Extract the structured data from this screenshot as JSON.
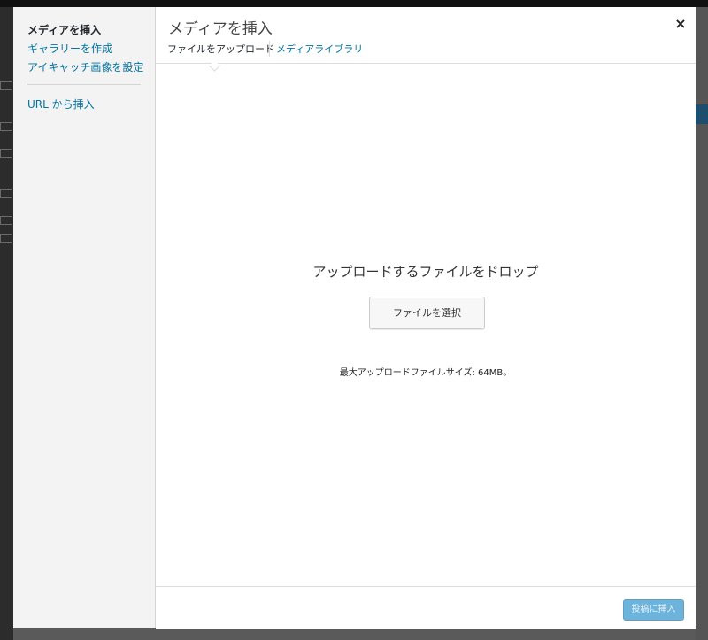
{
  "modal": {
    "menu": {
      "items": [
        {
          "label": "メディアを挿入",
          "active": true
        },
        {
          "label": "ギャラリーを作成",
          "active": false
        },
        {
          "label": "アイキャッチ画像を設定",
          "active": false
        },
        {
          "label": "URL から挿入",
          "active": false
        }
      ]
    },
    "title": "メディアを挿入",
    "close_glyph": "×",
    "tabs": [
      {
        "label": "ファイルをアップロード",
        "active": true
      },
      {
        "label": "メディアライブラリ",
        "active": false
      }
    ],
    "uploader": {
      "drop_text": "アップロードするファイルをドロップ",
      "select_button": "ファイルを選択",
      "max_size": "最大アップロードファイルサイズ: 64MB。"
    },
    "toolbar": {
      "insert_button": "投稿に挿入"
    }
  },
  "colors": {
    "link": "#0074a2",
    "primary_button_disabled": "#6db4dc",
    "menu_background": "#f3f3f3"
  }
}
